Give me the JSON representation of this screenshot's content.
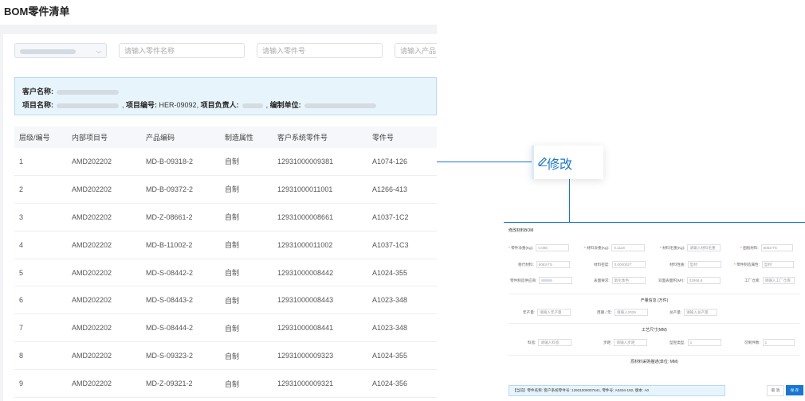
{
  "page": {
    "title": "BOM零件清单"
  },
  "filters": {
    "customer_select": "",
    "part_name_placeholder": "请输入零件名称",
    "part_no_placeholder": "请输入零件号",
    "product_placeholder": "请输入产品"
  },
  "info": {
    "customer_label": "客户名称:",
    "project_name_label": "项目名称:",
    "project_no_label": "项目编号:",
    "project_no": "HER-09092",
    "owner_label": "项目负责人:",
    "unit_label": "编制单位:"
  },
  "table": {
    "headers": [
      "层级/编号",
      "内部项目号",
      "产品编码",
      "制造属性",
      "客户系统零件号",
      "零件号"
    ],
    "rows": [
      [
        "1",
        "AMD202202",
        "MD-B-09318-2",
        "自制",
        "12931000009381",
        "A1074-126"
      ],
      [
        "2",
        "AMD202202",
        "MD-B-09372-2",
        "自制",
        "12931000011001",
        "A1266-413"
      ],
      [
        "3",
        "AMD202202",
        "MD-Z-08661-2",
        "自制",
        "12931000008661",
        "A1037-1C2"
      ],
      [
        "4",
        "AMD202202",
        "MD-B-11002-2",
        "自制",
        "12931000011002",
        "A1037-1C3"
      ],
      [
        "5",
        "AMD202202",
        "MD-S-08442-2",
        "自制",
        "12931000008442",
        "A1024-355"
      ],
      [
        "6",
        "AMD202202",
        "MD-S-08443-2",
        "自制",
        "12931000008443",
        "A1023-348"
      ],
      [
        "7",
        "AMD202202",
        "MD-S-08444-2",
        "自制",
        "12931000008441",
        "A1023-348"
      ],
      [
        "8",
        "AMD202202",
        "MD-S-09323-2",
        "自制",
        "12931000009323",
        "A1024-355"
      ],
      [
        "9",
        "AMD202202",
        "MD-Z-09321-2",
        "自制",
        "12931000009321",
        "A1024-356"
      ]
    ]
  },
  "callout": {
    "label": "修改"
  },
  "dialog": {
    "title": "修改材料BOM",
    "r1": [
      {
        "label": "零件净重(Kg):",
        "value": "0.086",
        "req": true
      },
      {
        "label": "材料净重(Kg):",
        "value": "0.1118",
        "req": true
      },
      {
        "label": "材料毛重(Kg):",
        "value": "请输入材料毛重",
        "req": true
      },
      {
        "label": "图纸材料:",
        "value": "6063-T5",
        "req": true
      }
    ],
    "r2": [
      {
        "label": "替代材料:",
        "value": "6063-T5"
      },
      {
        "label": "材料密度:",
        "value": "0.0000027"
      },
      {
        "label": "材料性质:",
        "value": "型材"
      },
      {
        "label": "零件制造属性:",
        "value": "型材",
        "req": true
      }
    ],
    "r3": [
      {
        "label": "零件制造供应商:",
        "value": ""
      },
      {
        "label": "表面要求:",
        "value": "氧化本色"
      },
      {
        "label": "双面表面积(M²):",
        "value": "31866.8"
      },
      {
        "label": "工厂仓库:",
        "value": "请输入工厂仓库"
      }
    ],
    "sec1": "产量信息 (万件)",
    "r4": [
      {
        "label": "年产量:",
        "value": "请输入年产量"
      },
      {
        "label": "周期 / 年:",
        "value": "请输入2026"
      },
      {
        "label": "总产量:",
        "value": "请输入总产量"
      }
    ],
    "sec2": "工艺尺寸(MM)",
    "r5": [
      {
        "label": "料宽:",
        "value": "请输入料宽"
      },
      {
        "label": "步距:",
        "value": "请输入步距"
      },
      {
        "label": "型腔类型:",
        "value": "1"
      },
      {
        "label": "可制件数:",
        "value": "1"
      }
    ],
    "sec3": "原材料采购描述(单位: MM)",
    "footer": "【当前】零件名称:                  客户系统零件号: 12931000007641,  零件号: A0404-192,  版本: A0",
    "cancel": "取 消",
    "save": "保 存"
  }
}
